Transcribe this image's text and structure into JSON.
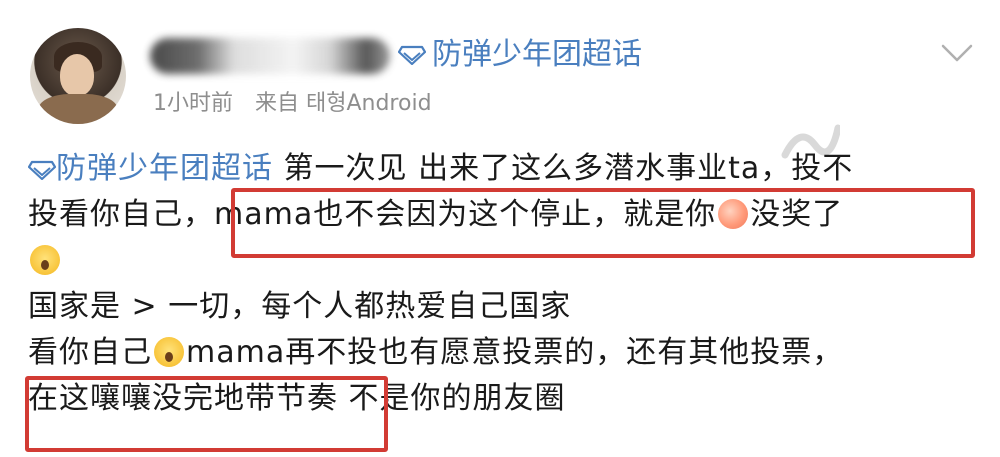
{
  "header": {
    "supertopic_label": "防弹少年团超话",
    "time": "1小时前",
    "source": "来自 태형Android"
  },
  "post": {
    "line1_topic": "防弹少年团超话",
    "line1_text": " 第一次见 出来了这么多潜水事业ta，投不",
    "line2_a": "投看你自己，",
    "line2_b": "mama也不会因为这个停止，就是你",
    "line2_c": "没奖了",
    "line4": "国家是 > 一切，每个人都热爱自己国家",
    "line5_a": "看你自己",
    "line5_b": "mama再不投也有愿意投票的，还有其他投票，",
    "line6_a": "在这嚷嚷没完地带节奏",
    "line6_b": " 不是你的朋友圈"
  },
  "icons": {
    "topic": "diamond-icon",
    "more": "chevron-down-icon",
    "emoji_peach": "peach-emoji",
    "emoji_shock": "shocked-face-emoji"
  },
  "colors": {
    "topic_blue": "#4a7fbf",
    "highlight_red": "#d23b34",
    "meta_gray": "#8e8e8e"
  }
}
